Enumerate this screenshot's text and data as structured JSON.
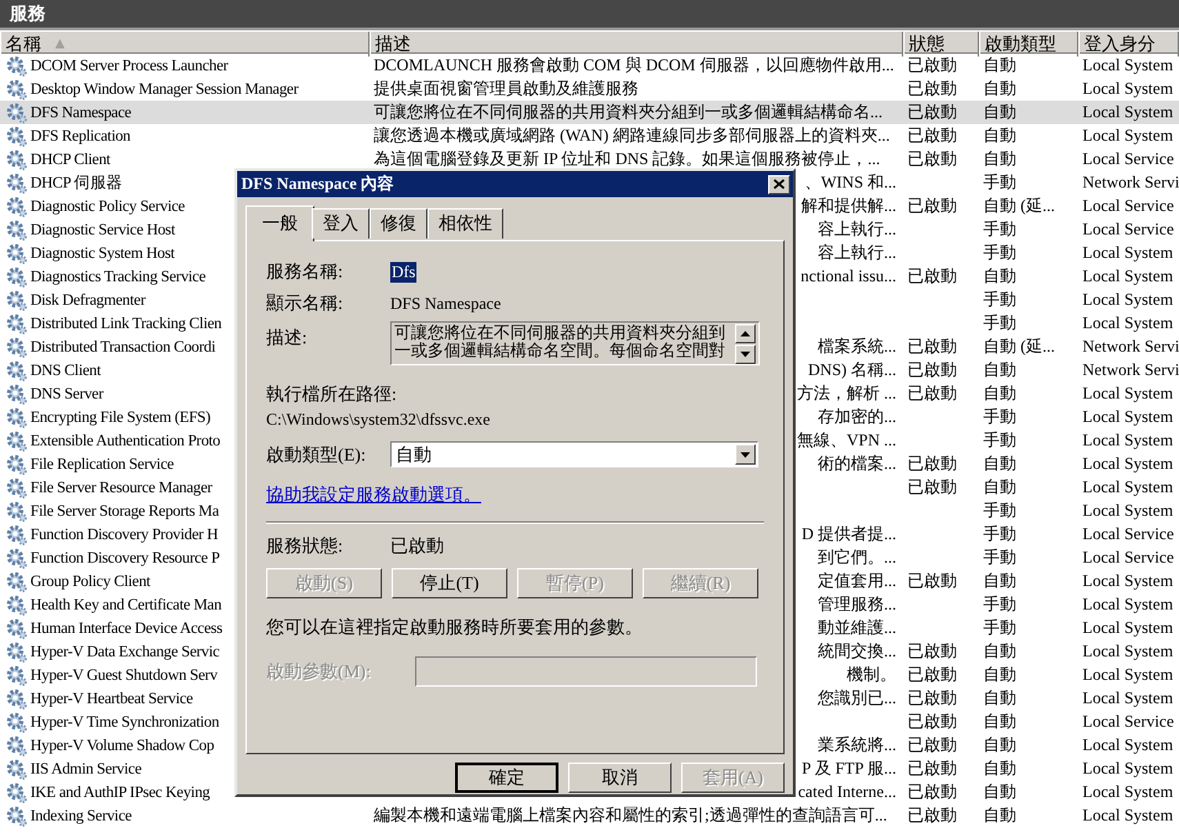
{
  "window": {
    "title": "服務"
  },
  "table": {
    "columns": [
      {
        "label": "名稱",
        "sort_indicator": "▲"
      },
      {
        "label": "描述"
      },
      {
        "label": "狀態"
      },
      {
        "label": "啟動類型"
      },
      {
        "label": "登入身分"
      }
    ],
    "rows": [
      {
        "name": "DCOM Server Process Launcher",
        "description": "DCOMLAUNCH 服務會啟動 COM 與 DCOM 伺服器，以回應物件啟用...",
        "status": "已啟動",
        "startup_type": "自動",
        "log_on_as": "Local System",
        "selected": false
      },
      {
        "name": "Desktop Window Manager Session Manager",
        "description": "提供桌面視窗管理員啟動及維護服務",
        "status": "已啟動",
        "startup_type": "自動",
        "log_on_as": "Local System",
        "selected": false
      },
      {
        "name": "DFS Namespace",
        "description": "可讓您將位在不同伺服器的共用資料夾分組到一或多個邏輯結構命名...",
        "status": "已啟動",
        "startup_type": "自動",
        "log_on_as": "Local System",
        "selected": true
      },
      {
        "name": "DFS Replication",
        "description": "讓您透過本機或廣域網路 (WAN) 網路連線同步多部伺服器上的資料夾...",
        "status": "已啟動",
        "startup_type": "自動",
        "log_on_as": "Local System",
        "selected": false
      },
      {
        "name": "DHCP Client",
        "description": "為這個電腦登錄及更新 IP 位址和 DNS 記錄。如果這個服務被停止，...",
        "status": "已啟動",
        "startup_type": "自動",
        "log_on_as": "Local Service",
        "selected": false
      },
      {
        "name": "DHCP 伺服器",
        "description_tail": "、WINS 和...",
        "startup_type": "手動",
        "log_on_as": "Network Servi",
        "selected": false
      },
      {
        "name": "Diagnostic Policy Service",
        "description_tail": "解和提供解...",
        "status": "已啟動",
        "startup_type": "自動 (延...",
        "log_on_as": "Local Service",
        "selected": false
      },
      {
        "name": "Diagnostic Service Host",
        "description_tail": "容上執行...",
        "startup_type": "手動",
        "log_on_as": "Local Service",
        "selected": false
      },
      {
        "name": "Diagnostic System Host",
        "description_tail": "容上執行...",
        "startup_type": "手動",
        "log_on_as": "Local System",
        "selected": false
      },
      {
        "name": "Diagnostics Tracking Service",
        "description_tail": "nctional issu...",
        "status": "已啟動",
        "startup_type": "自動",
        "log_on_as": "Local System",
        "selected": false
      },
      {
        "name": "Disk Defragmenter",
        "startup_type": "手動",
        "log_on_as": "Local System",
        "selected": false
      },
      {
        "name": "Distributed Link Tracking Clien",
        "startup_type": "手動",
        "log_on_as": "Local System",
        "selected": false
      },
      {
        "name": "Distributed Transaction Coordi",
        "description_tail": "檔案系統...",
        "status": "已啟動",
        "startup_type": "自動 (延...",
        "log_on_as": "Network Servi",
        "selected": false
      },
      {
        "name": "DNS Client",
        "description_tail": "DNS) 名稱...",
        "status": "已啟動",
        "startup_type": "自動",
        "log_on_as": "Network Servi",
        "selected": false
      },
      {
        "name": "DNS Server",
        "description_tail": "方法，解析 ...",
        "status": "已啟動",
        "startup_type": "自動",
        "log_on_as": "Local System",
        "selected": false
      },
      {
        "name": "Encrypting File System (EFS)",
        "description_tail": "存加密的...",
        "startup_type": "手動",
        "log_on_as": "Local System",
        "selected": false
      },
      {
        "name": "Extensible Authentication Proto",
        "description_tail": "無線、VPN ...",
        "startup_type": "手動",
        "log_on_as": "Local System",
        "selected": false
      },
      {
        "name": "File Replication Service",
        "description_tail": "術的檔案...",
        "status": "已啟動",
        "startup_type": "自動",
        "log_on_as": "Local System",
        "selected": false
      },
      {
        "name": "File Server Resource Manager",
        "status": "已啟動",
        "startup_type": "自動",
        "log_on_as": "Local System",
        "selected": false
      },
      {
        "name": "File Server Storage Reports Ma",
        "startup_type": "手動",
        "log_on_as": "Local System",
        "selected": false
      },
      {
        "name": "Function Discovery Provider H",
        "description_tail": "D 提供者提...",
        "startup_type": "手動",
        "log_on_as": "Local Service",
        "selected": false
      },
      {
        "name": "Function Discovery Resource P",
        "description_tail": "到它們。...",
        "startup_type": "手動",
        "log_on_as": "Local Service",
        "selected": false
      },
      {
        "name": "Group Policy Client",
        "description_tail": "定值套用...",
        "status": "已啟動",
        "startup_type": "自動",
        "log_on_as": "Local System",
        "selected": false
      },
      {
        "name": "Health Key and Certificate Man",
        "description_tail": "管理服務...",
        "startup_type": "手動",
        "log_on_as": "Local System",
        "selected": false
      },
      {
        "name": "Human Interface Device Access",
        "description_tail": "動並維護...",
        "startup_type": "手動",
        "log_on_as": "Local System",
        "selected": false
      },
      {
        "name": "Hyper-V Data Exchange Servic",
        "description_tail": "統間交換...",
        "status": "已啟動",
        "startup_type": "自動",
        "log_on_as": "Local System",
        "selected": false
      },
      {
        "name": "Hyper-V Guest Shutdown Serv",
        "description_tail": "機制。",
        "status": "已啟動",
        "startup_type": "自動",
        "log_on_as": "Local System",
        "selected": false
      },
      {
        "name": "Hyper-V Heartbeat Service",
        "description_tail": "您識別已...",
        "status": "已啟動",
        "startup_type": "自動",
        "log_on_as": "Local System",
        "selected": false
      },
      {
        "name": "Hyper-V Time Synchronization",
        "status": "已啟動",
        "startup_type": "自動",
        "log_on_as": "Local Service",
        "selected": false
      },
      {
        "name": "Hyper-V Volume Shadow Cop",
        "description_tail": "業系統將...",
        "status": "已啟動",
        "startup_type": "自動",
        "log_on_as": "Local System",
        "selected": false
      },
      {
        "name": "IIS Admin Service",
        "description_tail": "P 及 FTP 服...",
        "status": "已啟動",
        "startup_type": "自動",
        "log_on_as": "Local System",
        "selected": false
      },
      {
        "name": "IKE and AuthIP IPsec Keying",
        "description_tail": "cated Interne...",
        "status": "已啟動",
        "startup_type": "自動",
        "log_on_as": "Local System",
        "selected": false
      },
      {
        "name": "Indexing Service",
        "description": "編製本機和遠端電腦上檔案內容和屬性的索引;透過彈性的查詢語言可...",
        "status": "已啟動",
        "startup_type": "自動",
        "log_on_as": "Local System",
        "selected": false
      }
    ]
  },
  "dialog": {
    "title": "DFS Namespace 內容",
    "tabs": [
      {
        "label": "一般",
        "selected": true
      },
      {
        "label": "登入",
        "selected": false
      },
      {
        "label": "修復",
        "selected": false
      },
      {
        "label": "相依性",
        "selected": false
      }
    ],
    "service_name": {
      "label": "服務名稱:",
      "value": "Dfs"
    },
    "display_name": {
      "label": "顯示名稱:",
      "value": "DFS Namespace"
    },
    "description": {
      "label": "描述:",
      "lines": [
        "可讓您將位在不同伺服器的共用資料夾分組到",
        "一或多個邏輯結構命名空間。每個命名空間對"
      ]
    },
    "path": {
      "label": "執行檔所在路徑:",
      "value": "C:\\Windows\\system32\\dfssvc.exe"
    },
    "startup_type": {
      "label": "啟動類型(E):",
      "value": "自動"
    },
    "help_link": "協助我設定服務啟動選項。",
    "service_status": {
      "label": "服務狀態:",
      "value": "已啟動"
    },
    "service_buttons": [
      {
        "label": "啟動(S)",
        "disabled": true
      },
      {
        "label": "停止(T)",
        "disabled": false
      },
      {
        "label": "暫停(P)",
        "disabled": true
      },
      {
        "label": "繼續(R)",
        "disabled": true
      }
    ],
    "params_note": "您可以在這裡指定啟動服務時所要套用的參數。",
    "start_params": {
      "label": "啟動參數(M):",
      "disabled": true
    },
    "buttons": [
      {
        "label": "確定",
        "default": true,
        "disabled": false
      },
      {
        "label": "取消",
        "default": false,
        "disabled": false
      },
      {
        "label": "套用(A)",
        "default": false,
        "disabled": true
      }
    ]
  }
}
